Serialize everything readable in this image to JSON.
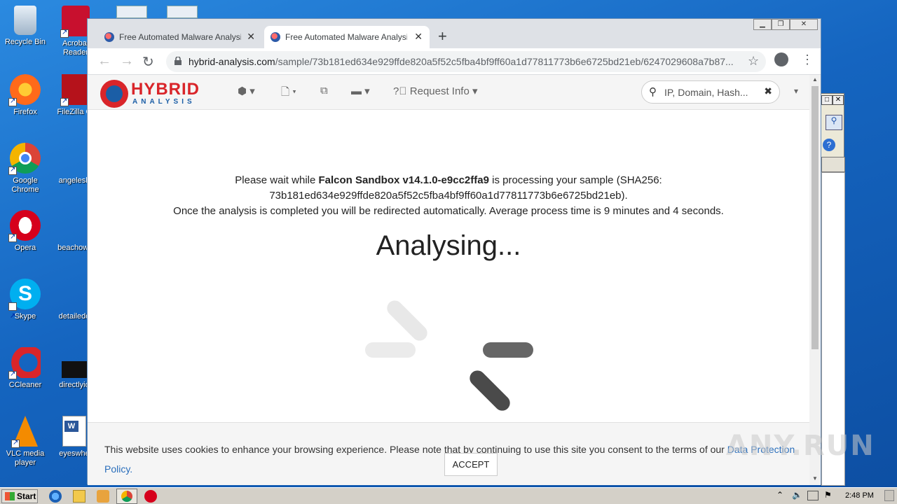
{
  "desktop": {
    "icons": [
      {
        "label": "Recycle Bin"
      },
      {
        "label": "Acrobat Reader"
      },
      {
        "label": "Firefox"
      },
      {
        "label": "FileZilla C"
      },
      {
        "label": "Google Chrome"
      },
      {
        "label": "angelesh"
      },
      {
        "label": "Opera"
      },
      {
        "label": "beachowr"
      },
      {
        "label": "Skype"
      },
      {
        "label": "detailedd"
      },
      {
        "label": "CCleaner"
      },
      {
        "label": "directlyid"
      },
      {
        "label": "VLC media player"
      },
      {
        "label": "eyeswhe"
      }
    ]
  },
  "browser": {
    "tabs": [
      {
        "title": "Free Automated Malware Analysis Se",
        "close": "✕"
      },
      {
        "title": "Free Automated Malware Analysis Se",
        "close": "✕"
      }
    ],
    "new_tab": "+",
    "url_host": "hybrid-analysis.com",
    "url_path": "/sample/73b181ed634e929ffde820a5f52c5fba4bf9ff60a1d77811773b6e6725bd21eb/6247029608a7b87..."
  },
  "site": {
    "logo_top": "HYBRID",
    "logo_bottom": "ANALYSIS",
    "nav_request_info": "Request Info",
    "search_placeholder": "IP, Domain, Hash...",
    "msg_prefix": "Please wait while ",
    "msg_product": "Falcon Sandbox v14.1.0-e9cc2ffa9",
    "msg_middle": " is processing your sample (SHA256: 73b181ed634e929ffde820a5f52c5fba4bf9ff60a1d77811773b6e6725bd21eb).",
    "msg_line2": "Once the analysis is completed you will be redirected automatically. Average process time is 9 minutes and 4 seconds.",
    "analysing": "Analysing...",
    "cookie_text": "This website uses cookies to enhance your browsing experience. Please note that by continuing to use this site you consent to the terms of our ",
    "cookie_link": "Data Protection Policy.",
    "accept_label": "ACCEPT"
  },
  "watermark": "ANY.RUN",
  "taskbar": {
    "start_label": "Start",
    "clock": "2:48 PM"
  }
}
